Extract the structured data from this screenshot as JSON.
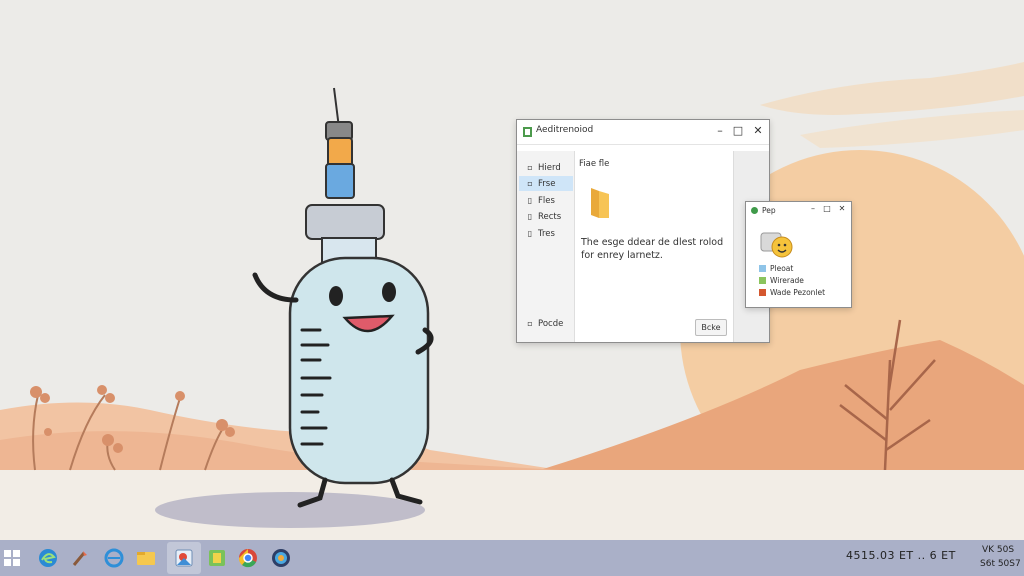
{
  "main_window": {
    "title": "Aeditrenoiod",
    "controls": {
      "minimize": "–",
      "maximize": "□",
      "close": "✕"
    },
    "sidebar": [
      {
        "icon": "▫",
        "label": "Hierd"
      },
      {
        "icon": "▫",
        "label": "Frse"
      },
      {
        "icon": "▯",
        "label": "Fles"
      },
      {
        "icon": "▯",
        "label": "Rects"
      },
      {
        "icon": "▯",
        "label": "Tres"
      }
    ],
    "sidebar_bottom": {
      "icon": "▫",
      "label": "Pocde"
    },
    "content_header": "Fiae fle",
    "message": "The esge ddear de dlest rolod for enrey larnetz.",
    "button_label": "Bcke"
  },
  "small_window": {
    "title": "Pep",
    "controls": {
      "minimize": "–",
      "maximize": "□",
      "close": "✕"
    },
    "items": [
      {
        "label": "Pleoat",
        "color": "#8fc4e8"
      },
      {
        "label": "Wirerade",
        "color": "#8bc45e"
      },
      {
        "label": "Wade Pezonlet",
        "color": "#d4572f"
      }
    ]
  },
  "taskbar": {
    "icons": [
      "start-icon",
      "edge-icon",
      "paint-icon",
      "ie-icon",
      "folder-icon",
      "photos-icon",
      "media-icon",
      "chrome-icon",
      "browser-icon"
    ],
    "tray_text": "4515.03 ET .. 6 ET",
    "tray_top": "VK 50S",
    "tray_bottom": "S6t 50S7"
  }
}
